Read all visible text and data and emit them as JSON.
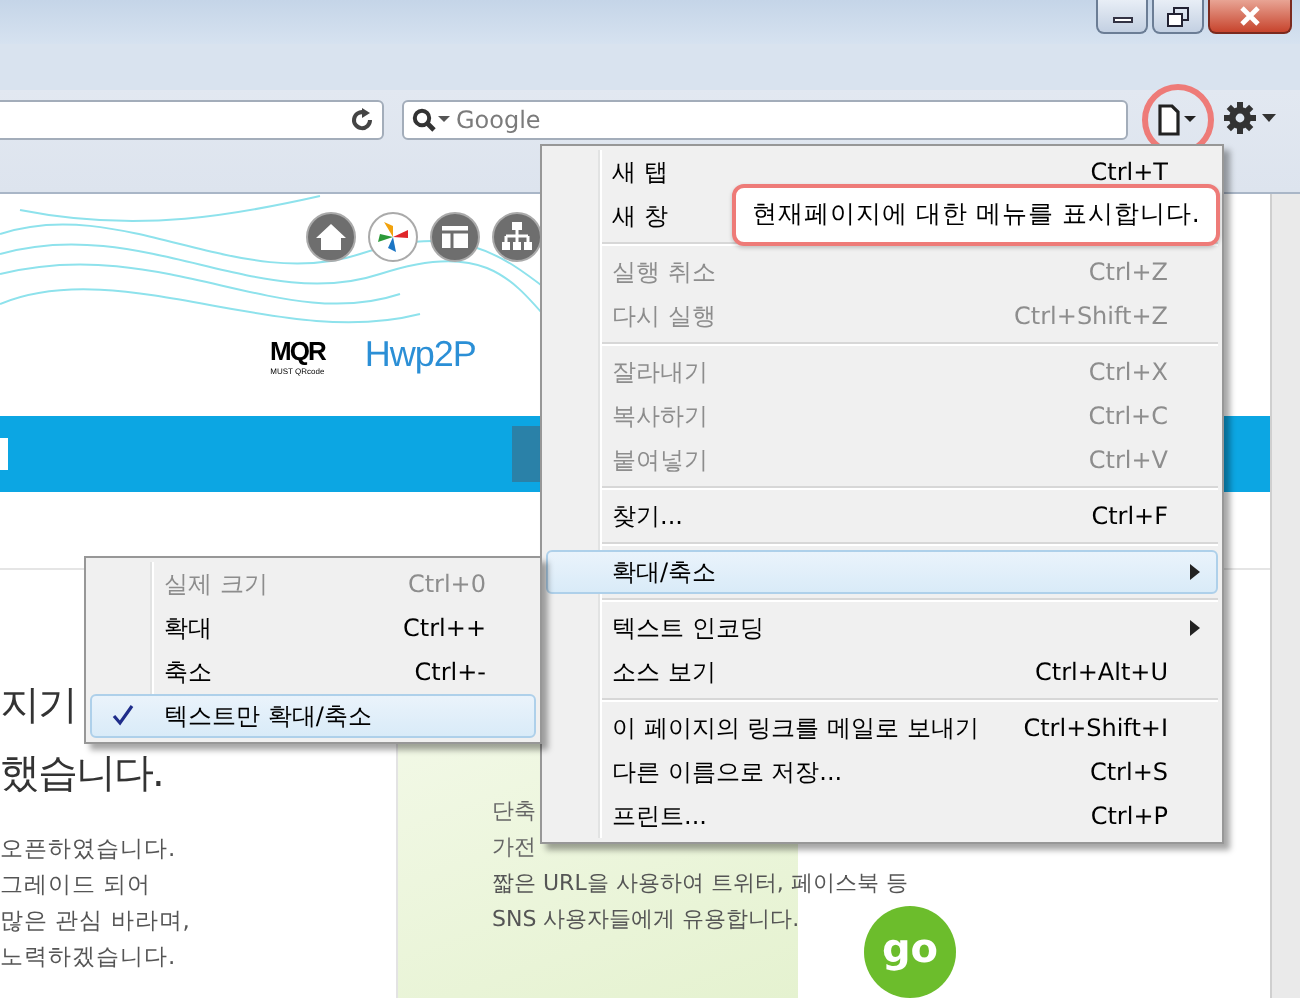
{
  "toolbar": {
    "search": {
      "placeholder": "Google"
    },
    "page_menu_button": {
      "highlighted": true
    }
  },
  "tooltip": {
    "text": "현재페이지에 대한 메뉴를 표시합니다."
  },
  "webpage": {
    "logos": [
      {
        "kind": "mqr",
        "text": "MQR",
        "subtext": "MUST QRcode"
      },
      {
        "kind": "hwp",
        "text": "Hwp2P"
      }
    ],
    "headline": [
      "지기",
      "했습니다."
    ],
    "body_lines": [
      "오픈하였습니다.",
      "그레이드 되어",
      "많은 관심 바라며,",
      "노력하겠습니다."
    ],
    "card": {
      "lines": [
        "단축",
        "가전"
      ],
      "description": [
        "짧은 URL을 사용하여 트위터, 페이스북 등",
        "SNS 사용자들에게 유용합니다."
      ],
      "go_button": "go"
    }
  },
  "menu": {
    "items": [
      {
        "kind": "item",
        "label": "새 탭",
        "shortcut": "Ctrl+T",
        "disabled": false,
        "selected": false
      },
      {
        "kind": "item",
        "label": "새 창",
        "disabled": false,
        "selected": false
      },
      {
        "kind": "separator"
      },
      {
        "kind": "item",
        "label": "실행 취소",
        "shortcut": "Ctrl+Z",
        "disabled": true,
        "selected": false
      },
      {
        "kind": "item",
        "label": "다시 실행",
        "shortcut": "Ctrl+Shift+Z",
        "disabled": true,
        "selected": false
      },
      {
        "kind": "separator"
      },
      {
        "kind": "item",
        "label": "잘라내기",
        "shortcut": "Ctrl+X",
        "disabled": true,
        "selected": false
      },
      {
        "kind": "item",
        "label": "복사하기",
        "shortcut": "Ctrl+C",
        "disabled": true,
        "selected": false
      },
      {
        "kind": "item",
        "label": "붙여넣기",
        "shortcut": "Ctrl+V",
        "disabled": true,
        "selected": false
      },
      {
        "kind": "separator"
      },
      {
        "kind": "item",
        "label": "찾기...",
        "shortcut": "Ctrl+F",
        "disabled": false,
        "selected": false
      },
      {
        "kind": "separator"
      },
      {
        "kind": "submenu",
        "label": "확대/축소",
        "disabled": false,
        "selected": true
      },
      {
        "kind": "separator"
      },
      {
        "kind": "submenu",
        "label": "텍스트 인코딩",
        "disabled": false,
        "selected": false
      },
      {
        "kind": "item",
        "label": "소스 보기",
        "shortcut": "Ctrl+Alt+U",
        "disabled": false,
        "selected": false
      },
      {
        "kind": "separator"
      },
      {
        "kind": "item",
        "label": "이 페이지의 링크를 메일로 보내기",
        "shortcut": "Ctrl+Shift+I",
        "disabled": false,
        "selected": false
      },
      {
        "kind": "item",
        "label": "다른 이름으로 저장...",
        "shortcut": "Ctrl+S",
        "disabled": false,
        "selected": false
      },
      {
        "kind": "item",
        "label": "프린트...",
        "shortcut": "Ctrl+P",
        "disabled": false,
        "selected": false
      }
    ]
  },
  "submenu": {
    "items": [
      {
        "kind": "item",
        "label": "실제 크기",
        "shortcut": "Ctrl+0",
        "disabled": true,
        "checked": false,
        "selected": false
      },
      {
        "kind": "item",
        "label": "확대",
        "shortcut": "Ctrl++",
        "disabled": false,
        "checked": false,
        "selected": false
      },
      {
        "kind": "item",
        "label": "축소",
        "shortcut": "Ctrl+-",
        "disabled": false,
        "checked": false,
        "selected": false
      },
      {
        "kind": "item",
        "label": "텍스트만 확대/축소",
        "disabled": false,
        "checked": true,
        "selected": true
      }
    ]
  }
}
